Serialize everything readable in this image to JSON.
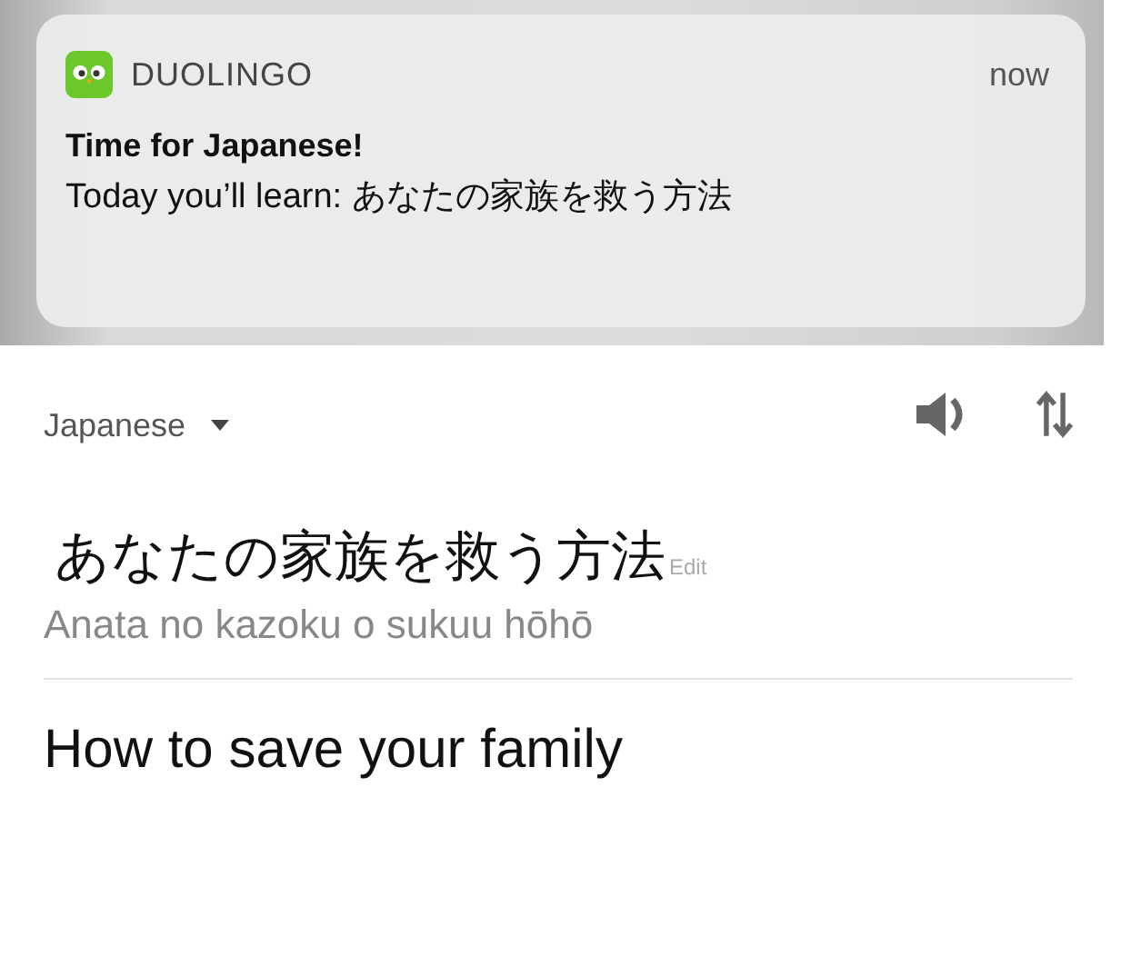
{
  "notification": {
    "app": "DUOLINGO",
    "time": "now",
    "title": "Time for Japanese!",
    "body": "Today you’ll learn: あなたの家族を救う方法"
  },
  "translator": {
    "language": "Japanese",
    "source_text": "あなたの家族を救う方法",
    "edit_label": "Edit",
    "romanization": "Anata no kazoku o sukuu hōhō",
    "translation": "How to save your family"
  }
}
